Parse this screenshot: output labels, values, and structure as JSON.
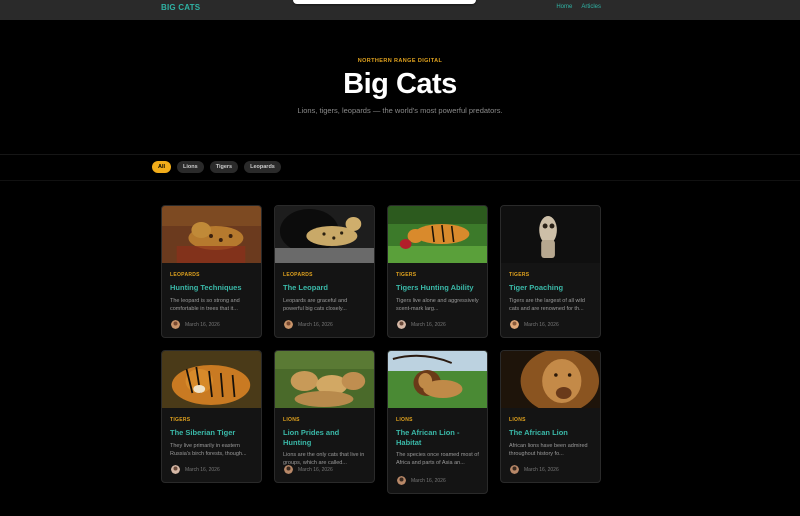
{
  "nav": {
    "brand": "BIG CATS",
    "links": [
      "Home",
      "Articles"
    ]
  },
  "hero": {
    "eyebrow": "NORTHERN RANGE DIGITAL",
    "title": "Big Cats",
    "subtitle": "Lions, tigers, leopards — the world's most powerful predators."
  },
  "filters": [
    "All",
    "Lions",
    "Tigers",
    "Leopards"
  ],
  "articles": [
    {
      "category": "LEOPARDS",
      "title": "Hunting Techniques",
      "excerpt": "The leopard is so strong and comfortable in trees that it...",
      "date": "March 16, 2026"
    },
    {
      "category": "LEOPARDS",
      "title": "The Leopard",
      "excerpt": "Leopards are graceful and powerful big cats closely...",
      "date": "March 16, 2026"
    },
    {
      "category": "TIGERS",
      "title": "Tigers Hunting Ability",
      "excerpt": "Tigers live alone and aggressively scent-mark larg...",
      "date": "March 16, 2026"
    },
    {
      "category": "TIGERS",
      "title": "Tiger Poaching",
      "excerpt": "Tigers are the largest of all wild cats and are renowned for th...",
      "date": "March 16, 2026"
    },
    {
      "category": "TIGERS",
      "title": "The Siberian Tiger",
      "excerpt": "They live primarily in eastern Russia's birch forests, though...",
      "date": "March 16, 2026"
    },
    {
      "category": "LIONS",
      "title": "Lion Prides and Hunting",
      "excerpt": "Lions are the only cats that live in groups, which are called...",
      "date": "March 16, 2026"
    },
    {
      "category": "LIONS",
      "title": "The African Lion - Habitat",
      "excerpt": "The species once roamed most of Africa and parts of Asia an...",
      "date": "March 16, 2026"
    },
    {
      "category": "LIONS",
      "title": "The African Lion",
      "excerpt": "African lions have been admired throughout history fo...",
      "date": "March 16, 2026"
    }
  ],
  "colors": {
    "accent": "#2fb3a4",
    "gold": "#e0a21e",
    "active_pill": "#f2ad1a"
  }
}
